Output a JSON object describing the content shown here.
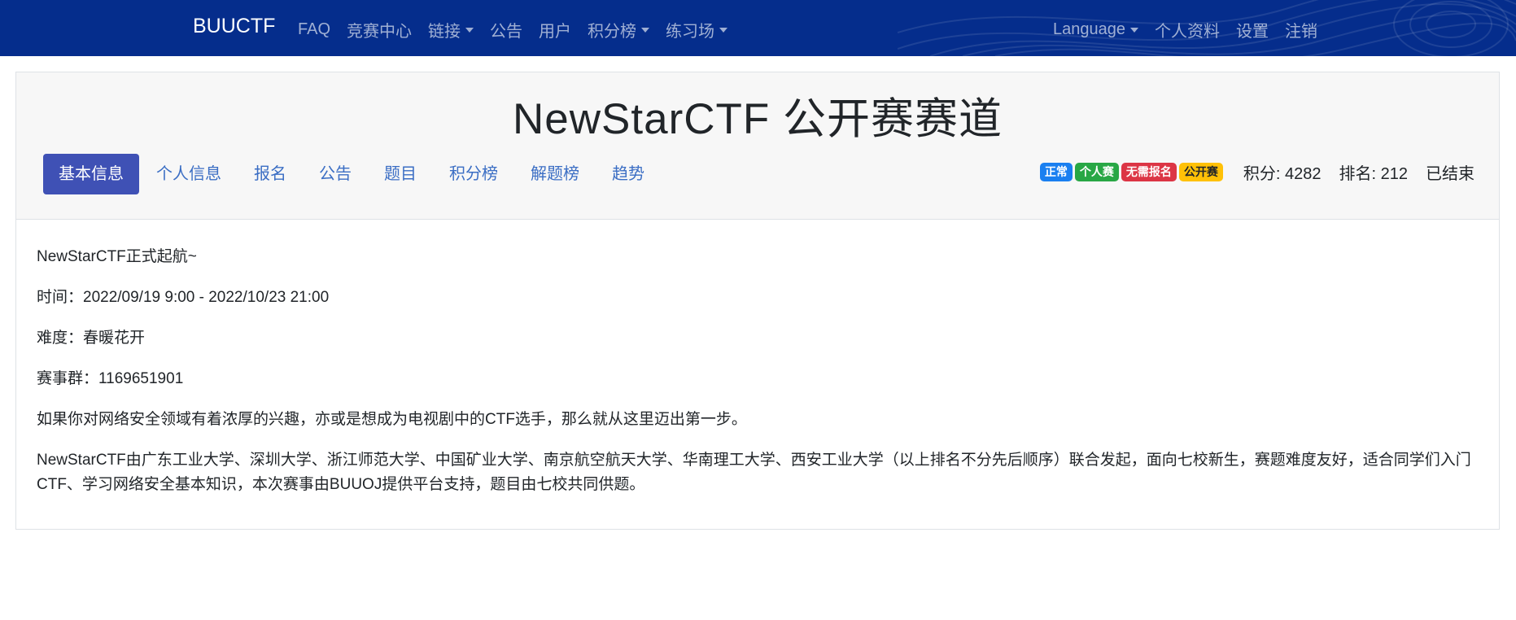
{
  "navbar": {
    "brand": "BUUCTF",
    "left_items": [
      {
        "label": "FAQ",
        "dropdown": false
      },
      {
        "label": "竞赛中心",
        "dropdown": false
      },
      {
        "label": "链接",
        "dropdown": true
      },
      {
        "label": "公告",
        "dropdown": false
      },
      {
        "label": "用户",
        "dropdown": false
      },
      {
        "label": "积分榜",
        "dropdown": true
      },
      {
        "label": "练习场",
        "dropdown": true
      }
    ],
    "right_items": [
      {
        "label": "Language",
        "dropdown": true
      },
      {
        "label": "个人资料",
        "dropdown": false
      },
      {
        "label": "设置",
        "dropdown": false
      },
      {
        "label": "注销",
        "dropdown": false
      }
    ],
    "bg_color": "#052d8c"
  },
  "contest": {
    "title": "NewStarCTF 公开赛赛道",
    "tabs": [
      {
        "label": "基本信息",
        "active": true
      },
      {
        "label": "个人信息",
        "active": false
      },
      {
        "label": "报名",
        "active": false
      },
      {
        "label": "公告",
        "active": false
      },
      {
        "label": "题目",
        "active": false
      },
      {
        "label": "积分榜",
        "active": false
      },
      {
        "label": "解题榜",
        "active": false
      },
      {
        "label": "趋势",
        "active": false
      }
    ],
    "badges": [
      {
        "label": "正常",
        "color": "#1a7ff0"
      },
      {
        "label": "个人赛",
        "color": "#28a745"
      },
      {
        "label": "无需报名",
        "color": "#dc3545"
      },
      {
        "label": "公开赛",
        "color": "#ffc107"
      }
    ],
    "score": "积分: 4282",
    "rank": "排名: 212",
    "status": "已结束"
  },
  "description": {
    "paragraphs": [
      "NewStarCTF正式起航~",
      "时间：2022/09/19 9:00 - 2022/10/23 21:00",
      "难度：春暖花开",
      "赛事群：1169651901",
      "如果你对网络安全领域有着浓厚的兴趣，亦或是想成为电视剧中的CTF选手，那么就从这里迈出第一步。",
      "NewStarCTF由广东工业大学、深圳大学、浙江师范大学、中国矿业大学、南京航空航天大学、华南理工大学、西安工业大学（以上排名不分先后顺序）联合发起，面向七校新生，赛题难度友好，适合同学们入门CTF、学习网络安全基本知识，本次赛事由BUUOJ提供平台支持，题目由七校共同供题。"
    ]
  }
}
